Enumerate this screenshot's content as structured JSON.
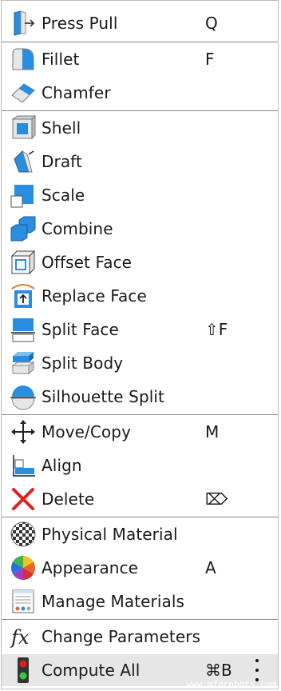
{
  "menu": {
    "items": [
      {
        "label": "Press Pull",
        "shortcut": "Q",
        "icon": "press-pull-icon"
      },
      {
        "label": "Fillet",
        "shortcut": "F",
        "icon": "fillet-icon"
      },
      {
        "label": "Chamfer",
        "shortcut": "",
        "icon": "chamfer-icon"
      },
      {
        "label": "Shell",
        "shortcut": "",
        "icon": "shell-icon"
      },
      {
        "label": "Draft",
        "shortcut": "",
        "icon": "draft-icon"
      },
      {
        "label": "Scale",
        "shortcut": "",
        "icon": "scale-icon"
      },
      {
        "label": "Combine",
        "shortcut": "",
        "icon": "combine-icon"
      },
      {
        "label": "Offset Face",
        "shortcut": "",
        "icon": "offset-face-icon"
      },
      {
        "label": "Replace Face",
        "shortcut": "",
        "icon": "replace-face-icon"
      },
      {
        "label": "Split Face",
        "shortcut": "⇧F",
        "icon": "split-face-icon"
      },
      {
        "label": "Split Body",
        "shortcut": "",
        "icon": "split-body-icon"
      },
      {
        "label": "Silhouette Split",
        "shortcut": "",
        "icon": "silhouette-split-icon"
      },
      {
        "label": "Move/Copy",
        "shortcut": "M",
        "icon": "move-copy-icon"
      },
      {
        "label": "Align",
        "shortcut": "",
        "icon": "align-icon"
      },
      {
        "label": "Delete",
        "shortcut": "⌦",
        "icon": "delete-icon"
      },
      {
        "label": "Physical Material",
        "shortcut": "",
        "icon": "physical-material-icon"
      },
      {
        "label": "Appearance",
        "shortcut": "A",
        "icon": "appearance-icon"
      },
      {
        "label": "Manage Materials",
        "shortcut": "",
        "icon": "manage-materials-icon"
      },
      {
        "label": "Change Parameters",
        "shortcut": "",
        "icon": "change-parameters-icon"
      },
      {
        "label": "Compute All",
        "shortcut": "⌘B",
        "icon": "compute-all-icon"
      }
    ]
  },
  "watermark": "www.mfgrobots.com"
}
